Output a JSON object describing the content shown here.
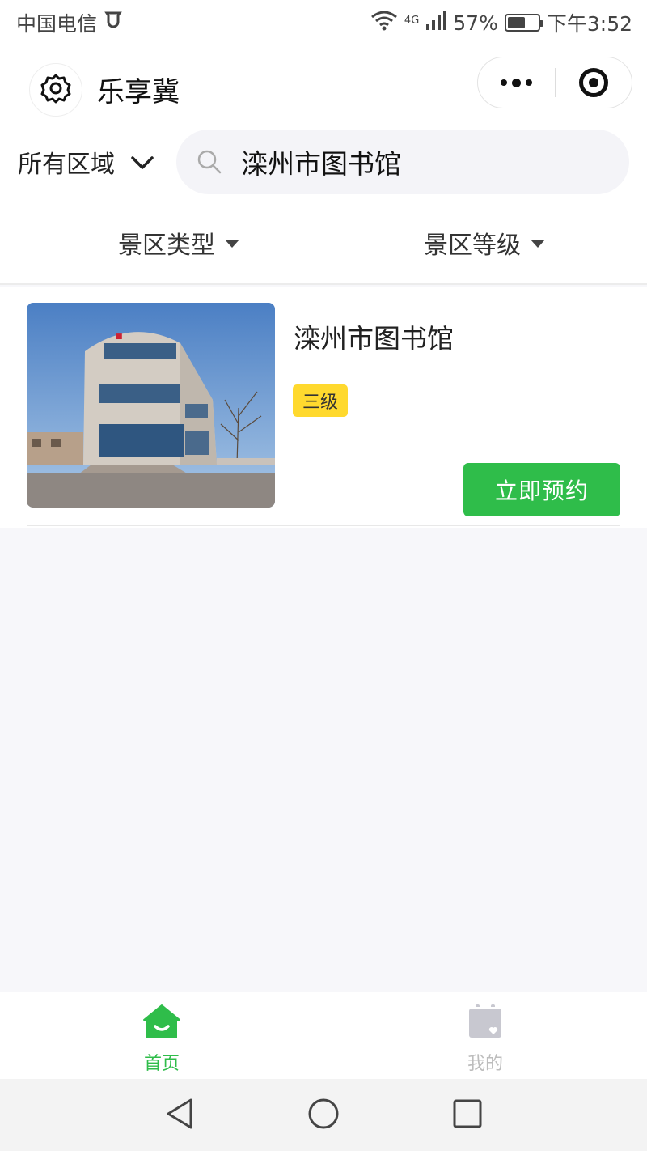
{
  "status_bar": {
    "carrier": "中国电信",
    "network": "4G",
    "battery_percent": "57%",
    "battery_level": 0.57,
    "time": "下午3:52"
  },
  "header": {
    "app_title": "乐享冀",
    "icons": {
      "settings": "gear-icon",
      "more": "more-dots-icon",
      "close": "target-circle-icon"
    }
  },
  "search": {
    "region_label": "所有区域",
    "query": "滦州市图书馆"
  },
  "filters": [
    {
      "label": "景区类型"
    },
    {
      "label": "景区等级"
    }
  ],
  "results": [
    {
      "name": "滦州市图书馆",
      "level": "三级",
      "book_label": "立即预约"
    }
  ],
  "tabbar": {
    "tabs": [
      {
        "label": "首页",
        "icon": "home-icon",
        "active": true
      },
      {
        "label": "我的",
        "icon": "calendar-icon",
        "active": false
      }
    ]
  },
  "colors": {
    "accent": "#2fbd4a",
    "badge": "#ffd92e",
    "inactive": "#bdbdbd",
    "background": "#f7f7fa"
  }
}
